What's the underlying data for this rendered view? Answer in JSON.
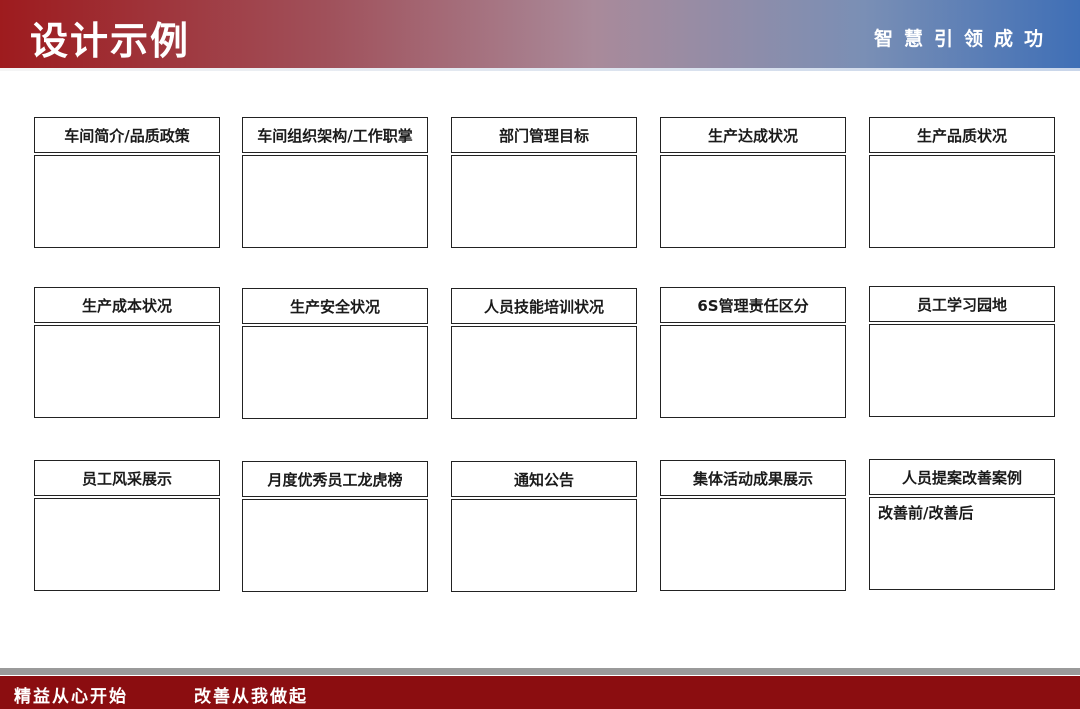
{
  "header": {
    "title": "设计示例",
    "slogan": "智慧引领成功"
  },
  "panels": [
    {
      "title": "车间简介/品质政策",
      "content": ""
    },
    {
      "title": "车间组织架构/工作职掌",
      "content": ""
    },
    {
      "title": "部门管理目标",
      "content": ""
    },
    {
      "title": "生产达成状况",
      "content": ""
    },
    {
      "title": "生产品质状况",
      "content": ""
    },
    {
      "title": "生产成本状况",
      "content": ""
    },
    {
      "title": "生产安全状况",
      "content": ""
    },
    {
      "title": "人员技能培训状况",
      "content": ""
    },
    {
      "title": "6S管理责任区分",
      "content": ""
    },
    {
      "title": "员工学习园地",
      "content": ""
    },
    {
      "title": "员工风采展示",
      "content": ""
    },
    {
      "title": "月度优秀员工龙虎榜",
      "content": ""
    },
    {
      "title": "通知公告",
      "content": ""
    },
    {
      "title": "集体活动成果展示",
      "content": ""
    },
    {
      "title": "人员提案改善案例",
      "content": "改善前/改善后"
    }
  ],
  "footer": {
    "slogan_left": "精益从心开始",
    "slogan_right": "改善从我做起"
  },
  "colors": {
    "header_left": "#9e1b1e",
    "header_right": "#3f6fb6",
    "footer": "#8b0d10"
  }
}
